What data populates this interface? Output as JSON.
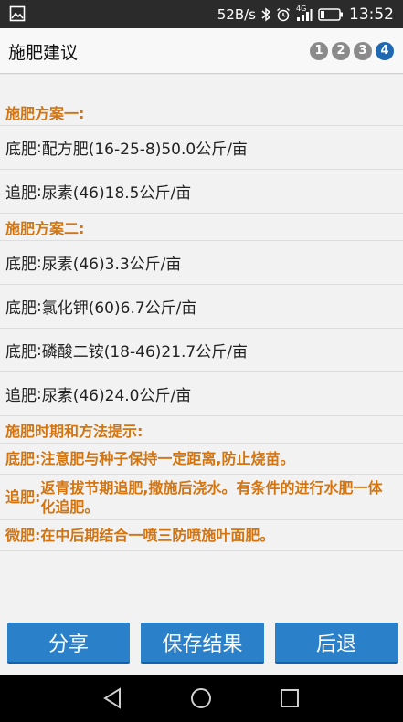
{
  "status_bar": {
    "speed": "52B/s",
    "network": "4G",
    "time": "13:52"
  },
  "header": {
    "title": "施肥建议",
    "steps": [
      "1",
      "2",
      "3",
      "4"
    ],
    "active_step": 4
  },
  "plan1": {
    "title": "施肥方案一:",
    "items": [
      {
        "label": "底肥",
        "sep": ":",
        "value": "配方肥(16-25-8)50.0公斤/亩"
      },
      {
        "label": "追肥",
        "sep": ":",
        "value": "尿素(46)18.5公斤/亩"
      }
    ]
  },
  "plan2": {
    "title": "施肥方案二:",
    "items": [
      {
        "label": "底肥",
        "sep": ":",
        "value": "尿素(46)3.3公斤/亩"
      },
      {
        "label": "底肥",
        "sep": ":",
        "value": "氯化钾(60)6.7公斤/亩"
      },
      {
        "label": "底肥",
        "sep": ":",
        "value": "磷酸二铵(18-46)21.7公斤/亩"
      },
      {
        "label": "追肥",
        "sep": ":",
        "value": "尿素(46)24.0公斤/亩"
      }
    ]
  },
  "tips": {
    "title": "施肥时期和方法提示:",
    "items": [
      {
        "label": "底肥:",
        "text": "注意肥与种子保持一定距离,防止烧苗。"
      },
      {
        "label": "追肥:",
        "text": "返青拔节期追肥,撒施后浇水。有条件的进行水肥一体化追肥。"
      },
      {
        "label": "微肥:",
        "text": "在中后期结合一喷三防喷施叶面肥。"
      }
    ]
  },
  "actions": {
    "share": "分享",
    "save": "保存结果",
    "back": "后退"
  },
  "colors": {
    "accent_orange": "#d47410",
    "button_blue": "#2a80c9",
    "active_step": "#1f69b3"
  }
}
